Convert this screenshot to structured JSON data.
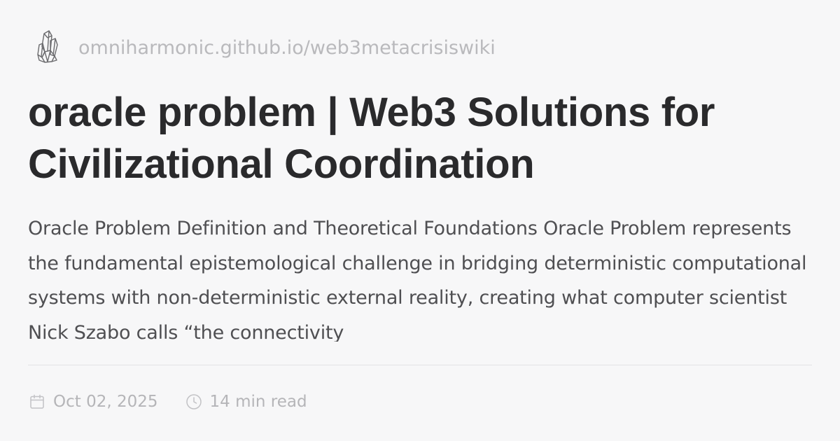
{
  "site": {
    "url": "omniharmonic.github.io/web3metacrisiswiki",
    "logo_icon": "crystal-cluster-icon"
  },
  "article": {
    "title": "oracle problem | Web3 Solutions for Civilizational Coordination",
    "excerpt": "Oracle Problem Definition and Theoretical Foundations Oracle Problem represents the fundamental epistemological challenge in bridging deterministic computational systems with non-deterministic external reality, creating what computer scientist Nick Szabo calls “the connectivity"
  },
  "meta": {
    "date": "Oct 02, 2025",
    "date_icon": "calendar-icon",
    "read_time": "14 min read",
    "read_time_icon": "clock-icon"
  },
  "colors": {
    "background": "#f7f7f8",
    "title": "#2a2a2c",
    "excerpt": "#4f4f52",
    "muted": "#b5b5b8",
    "divider": "#e3e3e5"
  }
}
